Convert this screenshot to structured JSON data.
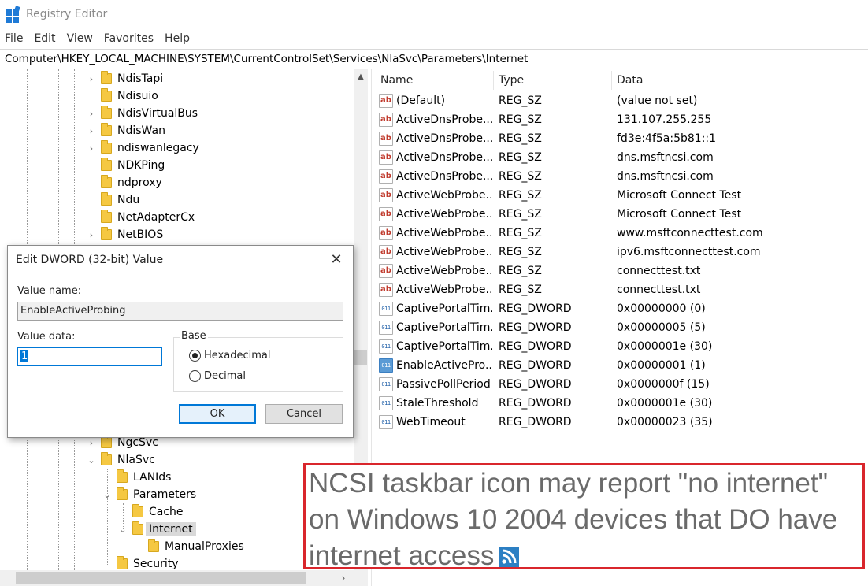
{
  "window": {
    "title": "Registry Editor"
  },
  "menu": [
    "File",
    "Edit",
    "View",
    "Favorites",
    "Help"
  ],
  "address": "Computer\\HKEY_LOCAL_MACHINE\\SYSTEM\\CurrentControlSet\\Services\\NlaSvc\\Parameters\\Internet",
  "tree": {
    "items": [
      {
        "label": "NdisTapi",
        "expander": "›"
      },
      {
        "label": "Ndisuio",
        "expander": ""
      },
      {
        "label": "NdisVirtualBus",
        "expander": "›"
      },
      {
        "label": "NdisWan",
        "expander": "›"
      },
      {
        "label": "ndiswanlegacy",
        "expander": "›"
      },
      {
        "label": "NDKPing",
        "expander": ""
      },
      {
        "label": "ndproxy",
        "expander": ""
      },
      {
        "label": "Ndu",
        "expander": ""
      },
      {
        "label": "NetAdapterCx",
        "expander": ""
      },
      {
        "label": "NetBIOS",
        "expander": "›"
      },
      {
        "label": "NgcSvc",
        "expander": "›"
      },
      {
        "label": "NlaSvc",
        "expander": "⌄"
      },
      {
        "label": "LANIds",
        "expander": ""
      },
      {
        "label": "Parameters",
        "expander": "⌄"
      },
      {
        "label": "Cache",
        "expander": ""
      },
      {
        "label": "Internet",
        "expander": "⌄"
      },
      {
        "label": "ManualProxies",
        "expander": ""
      },
      {
        "label": "Security",
        "expander": ""
      }
    ]
  },
  "values": {
    "columns": {
      "name": "Name",
      "type": "Type",
      "data": "Data"
    },
    "rows": [
      {
        "icon": "ab",
        "name": "(Default)",
        "type": "REG_SZ",
        "data": "(value not set)"
      },
      {
        "icon": "ab",
        "name": "ActiveDnsProbe...",
        "type": "REG_SZ",
        "data": "131.107.255.255"
      },
      {
        "icon": "ab",
        "name": "ActiveDnsProbe...",
        "type": "REG_SZ",
        "data": "fd3e:4f5a:5b81::1"
      },
      {
        "icon": "ab",
        "name": "ActiveDnsProbe...",
        "type": "REG_SZ",
        "data": "dns.msftncsi.com"
      },
      {
        "icon": "ab",
        "name": "ActiveDnsProbe...",
        "type": "REG_SZ",
        "data": "dns.msftncsi.com"
      },
      {
        "icon": "ab",
        "name": "ActiveWebProbe...",
        "type": "REG_SZ",
        "data": "Microsoft Connect Test"
      },
      {
        "icon": "ab",
        "name": "ActiveWebProbe...",
        "type": "REG_SZ",
        "data": "Microsoft Connect Test"
      },
      {
        "icon": "ab",
        "name": "ActiveWebProbe...",
        "type": "REG_SZ",
        "data": "www.msftconnecttest.com"
      },
      {
        "icon": "ab",
        "name": "ActiveWebProbe...",
        "type": "REG_SZ",
        "data": "ipv6.msftconnecttest.com"
      },
      {
        "icon": "ab",
        "name": "ActiveWebProbe...",
        "type": "REG_SZ",
        "data": "connecttest.txt"
      },
      {
        "icon": "ab",
        "name": "ActiveWebProbe...",
        "type": "REG_SZ",
        "data": "connecttest.txt"
      },
      {
        "icon": "dword",
        "name": "CaptivePortalTim...",
        "type": "REG_DWORD",
        "data": "0x00000000 (0)"
      },
      {
        "icon": "dword",
        "name": "CaptivePortalTim...",
        "type": "REG_DWORD",
        "data": "0x00000005 (5)"
      },
      {
        "icon": "dword",
        "name": "CaptivePortalTim...",
        "type": "REG_DWORD",
        "data": "0x0000001e (30)"
      },
      {
        "icon": "dword",
        "name": "EnableActivePro...",
        "type": "REG_DWORD",
        "data": "0x00000001 (1)",
        "selected": true
      },
      {
        "icon": "dword",
        "name": "PassivePollPeriod",
        "type": "REG_DWORD",
        "data": "0x0000000f (15)"
      },
      {
        "icon": "dword",
        "name": "StaleThreshold",
        "type": "REG_DWORD",
        "data": "0x0000001e (30)"
      },
      {
        "icon": "dword",
        "name": "WebTimeout",
        "type": "REG_DWORD",
        "data": "0x00000023 (35)"
      }
    ]
  },
  "dialog": {
    "title": "Edit DWORD (32-bit) Value",
    "close": "✕",
    "value_name_label": "Value name:",
    "value_name": "EnableActiveProbing",
    "value_data_label": "Value data:",
    "value_data": "1",
    "base_label": "Base",
    "hex_label": "Hexadecimal",
    "dec_label": "Decimal",
    "base_selected": "Hexadecimal",
    "ok": "OK",
    "cancel": "Cancel"
  },
  "headline": "NCSI taskbar icon may report \"no internet\" on Windows 10 2004 devices that DO have internet access",
  "colors": {
    "accent": "#0078d7",
    "headline_border": "#d9262c",
    "folder": "#f5c842"
  }
}
